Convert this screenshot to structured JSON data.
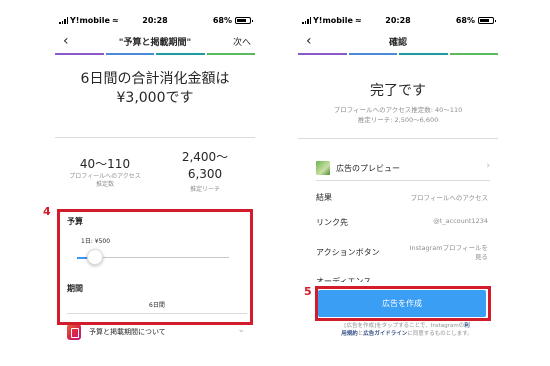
{
  "left_screen": {
    "status": {
      "carrier": "Y!mobile",
      "time": "20:28",
      "battery": "68%"
    },
    "nav": {
      "title": "\"予算と掲載期間\"",
      "next": "次へ"
    },
    "progress_colors": [
      "#8a58c8",
      "#4a8ad8",
      "#1f9aa0",
      "#5cb85c"
    ],
    "summary_line1": "6日間の合計消化金額は",
    "summary_line2": "¥3,000です",
    "metrics": [
      {
        "value": "40〜110",
        "label_line1": "プロフィールへのアクセス",
        "label_line2": "推定数"
      },
      {
        "value_line1": "2,400〜",
        "value_line2": "6,300",
        "label": "推定リーチ"
      }
    ],
    "budget": {
      "title": "予算",
      "daily_label": "1日: ¥500",
      "slider_fraction": 0.1
    },
    "period": {
      "title": "期間",
      "value": "6日間"
    },
    "faq": {
      "label": "予算と掲載期間について"
    },
    "step_label": "4"
  },
  "right_screen": {
    "status": {
      "carrier": "Y!mobile",
      "time": "20:28",
      "battery": "68%"
    },
    "nav": {
      "title": "確認"
    },
    "progress_colors": [
      "#8a58c8",
      "#4a8ad8",
      "#1f9aa0",
      "#5cb85c"
    ],
    "complete_title": "完了です",
    "estimate_line1": "プロフィールへのアクセス推定数: 40〜110",
    "estimate_line2": "推定リーチ: 2,500〜6,600",
    "preview_label": "広告のプレビュー",
    "rows": [
      {
        "key": "結果",
        "value": "プロフィールへのアクセス"
      },
      {
        "key": "リンク先",
        "value": "@t_account1234"
      },
      {
        "key": "アクションボタン",
        "value_line1": "Instagramプロフィールを",
        "value_line2": "見る"
      },
      {
        "key": "オーディエンス",
        "value": ""
      }
    ],
    "cta_label": "広告を作成",
    "terms_line1_a": "[広告を作成]をタップすることで、Instagramの",
    "terms_link1": "利",
    "terms_line2_link": "用規約",
    "terms_line2_mid": "と",
    "terms_link2": "広告ガイドライン",
    "terms_line2_end": "に同意するものとします。",
    "step_label": "5"
  }
}
